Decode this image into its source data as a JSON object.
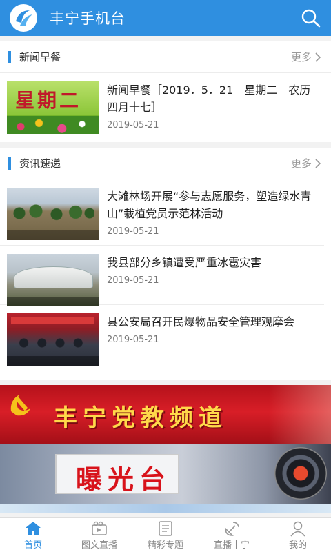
{
  "header": {
    "title": "丰宁手机台"
  },
  "sections": [
    {
      "title": "新闻早餐",
      "more": "更多",
      "items": [
        {
          "title": "新闻早餐［2019．5．21　星期二　农历四月十七］",
          "date": "2019-05-21",
          "thumb_text": "星期二"
        }
      ]
    },
    {
      "title": "资讯速递",
      "more": "更多",
      "items": [
        {
          "title": "大滩林场开展“参与志愿服务，塑造绿水青山”栽植党员示范林活动",
          "date": "2019-05-21"
        },
        {
          "title": "我县部分乡镇遭受严重冰雹灾害",
          "date": "2019-05-21"
        },
        {
          "title": "县公安局召开民爆物品安全管理观摩会",
          "date": "2019-05-21"
        }
      ]
    }
  ],
  "banners": [
    {
      "text": "丰宁党教频道",
      "color": "#c8161d"
    },
    {
      "text": "曝光台",
      "color": "#d8131b"
    }
  ],
  "tabs": [
    {
      "label": "首页",
      "icon": "home-icon",
      "active": true
    },
    {
      "label": "图文直播",
      "icon": "camera-icon",
      "active": false
    },
    {
      "label": "精彩专题",
      "icon": "book-icon",
      "active": false
    },
    {
      "label": "直播丰宁",
      "icon": "satellite-icon",
      "active": false
    },
    {
      "label": "我的",
      "icon": "user-icon",
      "active": false
    }
  ],
  "colors": {
    "primary": "#2f8fe0",
    "text": "#222222",
    "muted": "#777777"
  }
}
